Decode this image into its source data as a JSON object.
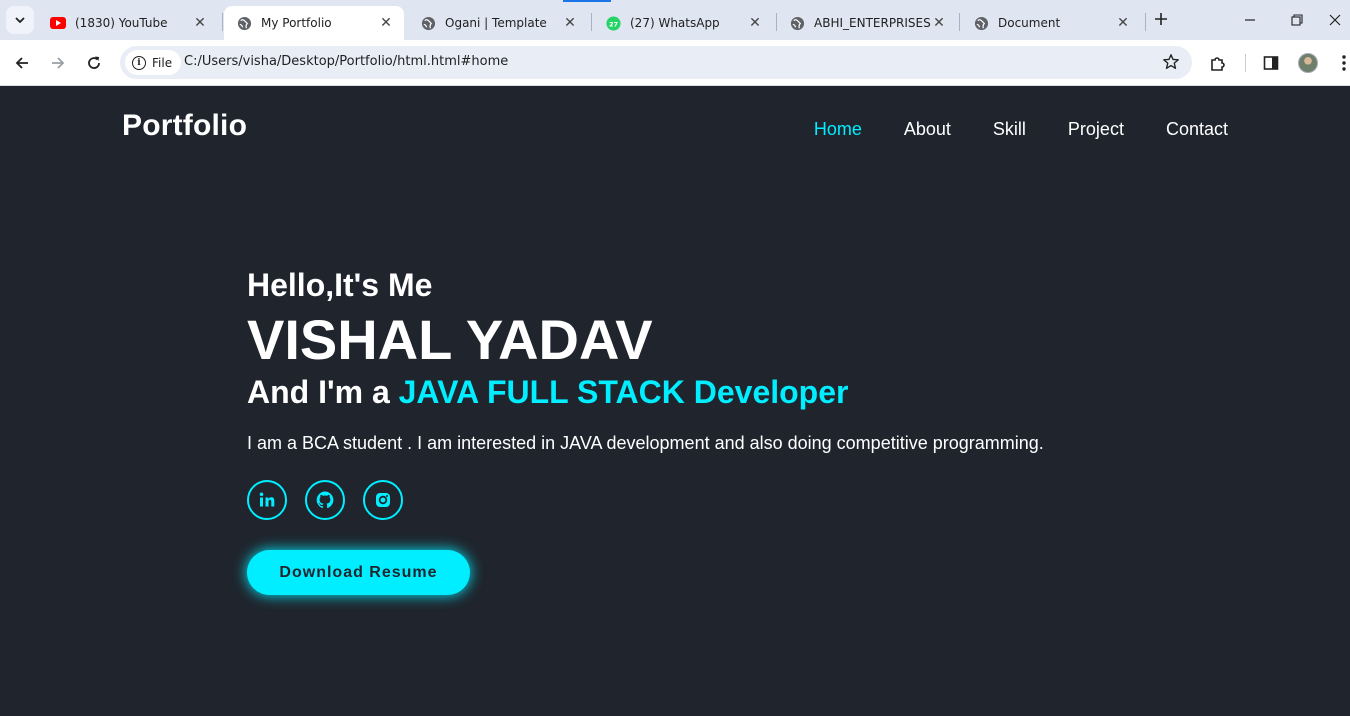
{
  "browser": {
    "tabs": [
      {
        "title": "(1830) YouTube",
        "icon": "youtube-icon",
        "active": false
      },
      {
        "title": "My Portfolio",
        "icon": "globe-icon",
        "active": true
      },
      {
        "title": "Ogani | Template",
        "icon": "globe-icon",
        "active": false
      },
      {
        "title": "(27) WhatsApp",
        "icon": "whatsapp-icon",
        "badge": "27",
        "active": false
      },
      {
        "title": "ABHI_ENTERPRISES",
        "icon": "globe-icon",
        "active": false
      },
      {
        "title": "Document",
        "icon": "globe-icon",
        "active": false
      }
    ],
    "chip_label": "File",
    "url": "C:/Users/visha/Desktop/Portfolio/html.html#home"
  },
  "page": {
    "logo": "Portfolio",
    "nav": [
      "Home",
      "About",
      "Skill",
      "Project",
      "Contact"
    ],
    "active_nav": "Home",
    "hello": "Hello,It's Me",
    "name": "VISHAL YADAV",
    "role_prefix": "And I'm a ",
    "role_accent": "JAVA FULL STACK Developer",
    "description": "I am a BCA student . I am interested in JAVA development and also doing competitive programming.",
    "socials": [
      "linkedin-icon",
      "github-icon",
      "instagram-icon"
    ],
    "button": "Download Resume"
  },
  "colors": {
    "background": "#1f242d",
    "accent": "#00eeff",
    "text": "#ffffff"
  }
}
